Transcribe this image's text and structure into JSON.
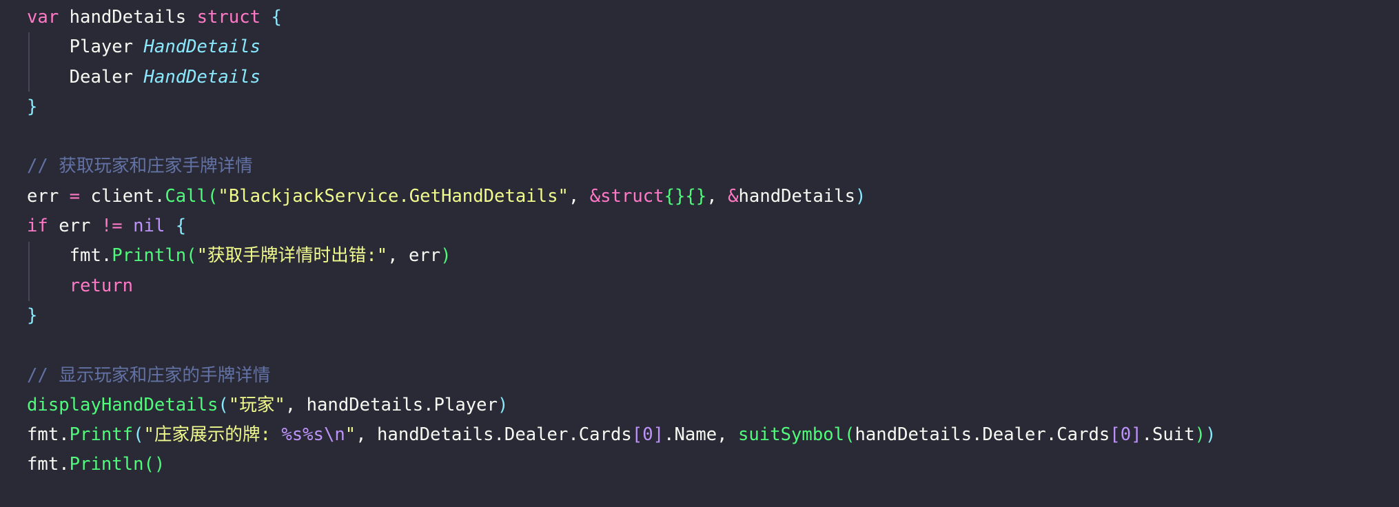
{
  "colors": {
    "background": "#2a2a37",
    "keyword": "#ff79c6",
    "type": "#8be9fd",
    "function": "#50fa7b",
    "string": "#f1fa8c",
    "comment": "#6272a4",
    "number": "#bd93f9",
    "text": "#f8f8f2"
  },
  "code_lines": [
    [
      [
        "var",
        "kw"
      ],
      [
        " handDetails ",
        "tx"
      ],
      [
        "struct",
        "kw"
      ],
      [
        " ",
        "tx"
      ],
      [
        "{",
        "br"
      ]
    ],
    [
      [
        "    Player ",
        "tx"
      ],
      [
        "HandDetails",
        "ty"
      ]
    ],
    [
      [
        "    Dealer ",
        "tx"
      ],
      [
        "HandDetails",
        "ty"
      ]
    ],
    [
      [
        "}",
        "br"
      ]
    ],
    [],
    [
      [
        "// 获取玩家和庄家手牌详情",
        "cm"
      ]
    ],
    [
      [
        "err ",
        "tx"
      ],
      [
        "=",
        "kw"
      ],
      [
        " client.",
        "tx"
      ],
      [
        "Call",
        "fn"
      ],
      [
        "(",
        "brg"
      ],
      [
        "\"BlackjackService.GetHandDetails\"",
        "str"
      ],
      [
        ", ",
        "tx"
      ],
      [
        "&struct",
        "kw"
      ],
      [
        "{}{}",
        "brg"
      ],
      [
        ", ",
        "tx"
      ],
      [
        "&",
        "kw"
      ],
      [
        "handDetails",
        "tx"
      ],
      [
        ")",
        "br"
      ]
    ],
    [
      [
        "if",
        "kw"
      ],
      [
        " err ",
        "tx"
      ],
      [
        "!=",
        "kw"
      ],
      [
        " ",
        "tx"
      ],
      [
        "nil",
        "num"
      ],
      [
        " ",
        "tx"
      ],
      [
        "{",
        "br"
      ]
    ],
    [
      [
        "    fmt.",
        "tx"
      ],
      [
        "Println",
        "fn"
      ],
      [
        "(",
        "brg"
      ],
      [
        "\"获取手牌详情时出错:\"",
        "str"
      ],
      [
        ", err",
        "tx"
      ],
      [
        ")",
        "brg"
      ]
    ],
    [
      [
        "    ",
        "tx"
      ],
      [
        "return",
        "kw"
      ]
    ],
    [
      [
        "}",
        "br"
      ]
    ],
    [],
    [
      [
        "// 显示玩家和庄家的手牌详情",
        "cm"
      ]
    ],
    [
      [
        "displayHandDetails",
        "fn"
      ],
      [
        "(",
        "br"
      ],
      [
        "\"玩家\"",
        "str"
      ],
      [
        ", handDetails.Player",
        "tx"
      ],
      [
        ")",
        "br"
      ]
    ],
    [
      [
        "fmt.",
        "tx"
      ],
      [
        "Printf",
        "fn"
      ],
      [
        "(",
        "br"
      ],
      [
        "\"庄家展示的牌: ",
        "str"
      ],
      [
        "%s%s\\n",
        "num"
      ],
      [
        "\"",
        "str"
      ],
      [
        ", handDetails.Dealer.Cards",
        "tx"
      ],
      [
        "[",
        "brp"
      ],
      [
        "0",
        "num"
      ],
      [
        "]",
        "brp"
      ],
      [
        ".Name, ",
        "tx"
      ],
      [
        "suitSymbol",
        "fn"
      ],
      [
        "(",
        "brg"
      ],
      [
        "handDetails.Dealer.Cards",
        "tx"
      ],
      [
        "[",
        "brp"
      ],
      [
        "0",
        "num"
      ],
      [
        "]",
        "brp"
      ],
      [
        ".Suit",
        "tx"
      ],
      [
        ")",
        "brg"
      ],
      [
        ")",
        "br"
      ]
    ],
    [
      [
        "fmt.",
        "tx"
      ],
      [
        "Println",
        "fn"
      ],
      [
        "()",
        "brg"
      ]
    ]
  ]
}
